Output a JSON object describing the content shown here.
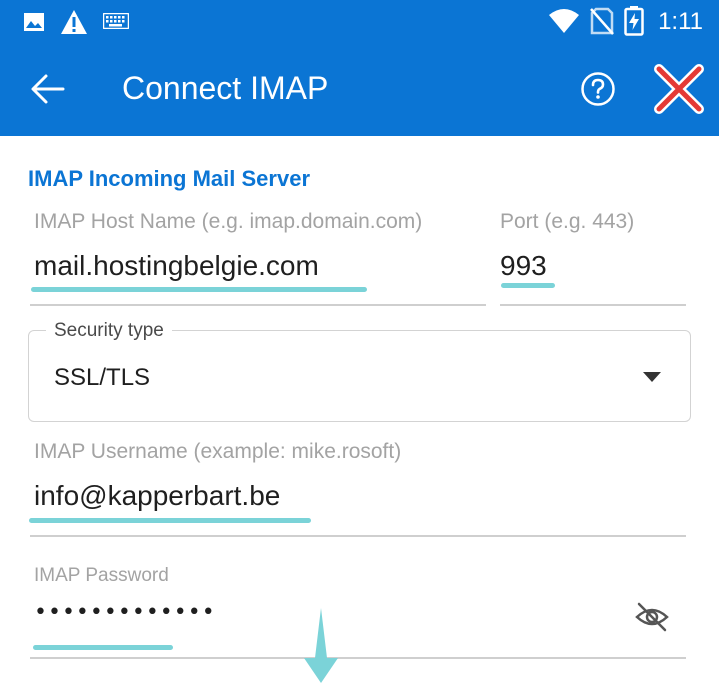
{
  "status_bar": {
    "time": "1:11",
    "icons": [
      "image-notification-icon",
      "warning-icon",
      "keyboard-icon",
      "wifi-icon",
      "no-sim-icon",
      "battery-charging-icon"
    ]
  },
  "app_bar": {
    "title": "Connect IMAP",
    "icons": [
      "back-arrow-icon",
      "help-icon",
      "close-icon"
    ]
  },
  "form": {
    "section_title": "IMAP Incoming Mail Server",
    "host": {
      "label": "IMAP Host Name (e.g. imap.domain.com)",
      "value": "mail.hostingbelgie.com"
    },
    "port": {
      "label": "Port (e.g. 443)",
      "value": "993"
    },
    "security": {
      "label": "Security type",
      "value": "SSL/TLS"
    },
    "username": {
      "label": "IMAP Username (example: mike.rosoft)",
      "value": "info@kapperbart.be"
    },
    "password": {
      "label": "IMAP Password",
      "value": "•••••••••••••"
    }
  },
  "colors": {
    "app_bar": "#0b75d4",
    "accent": "#0b75d4",
    "highlight": "#7bd3d8",
    "close_icon": "#e53935",
    "pointer_arrow": "#7bd3d8"
  }
}
